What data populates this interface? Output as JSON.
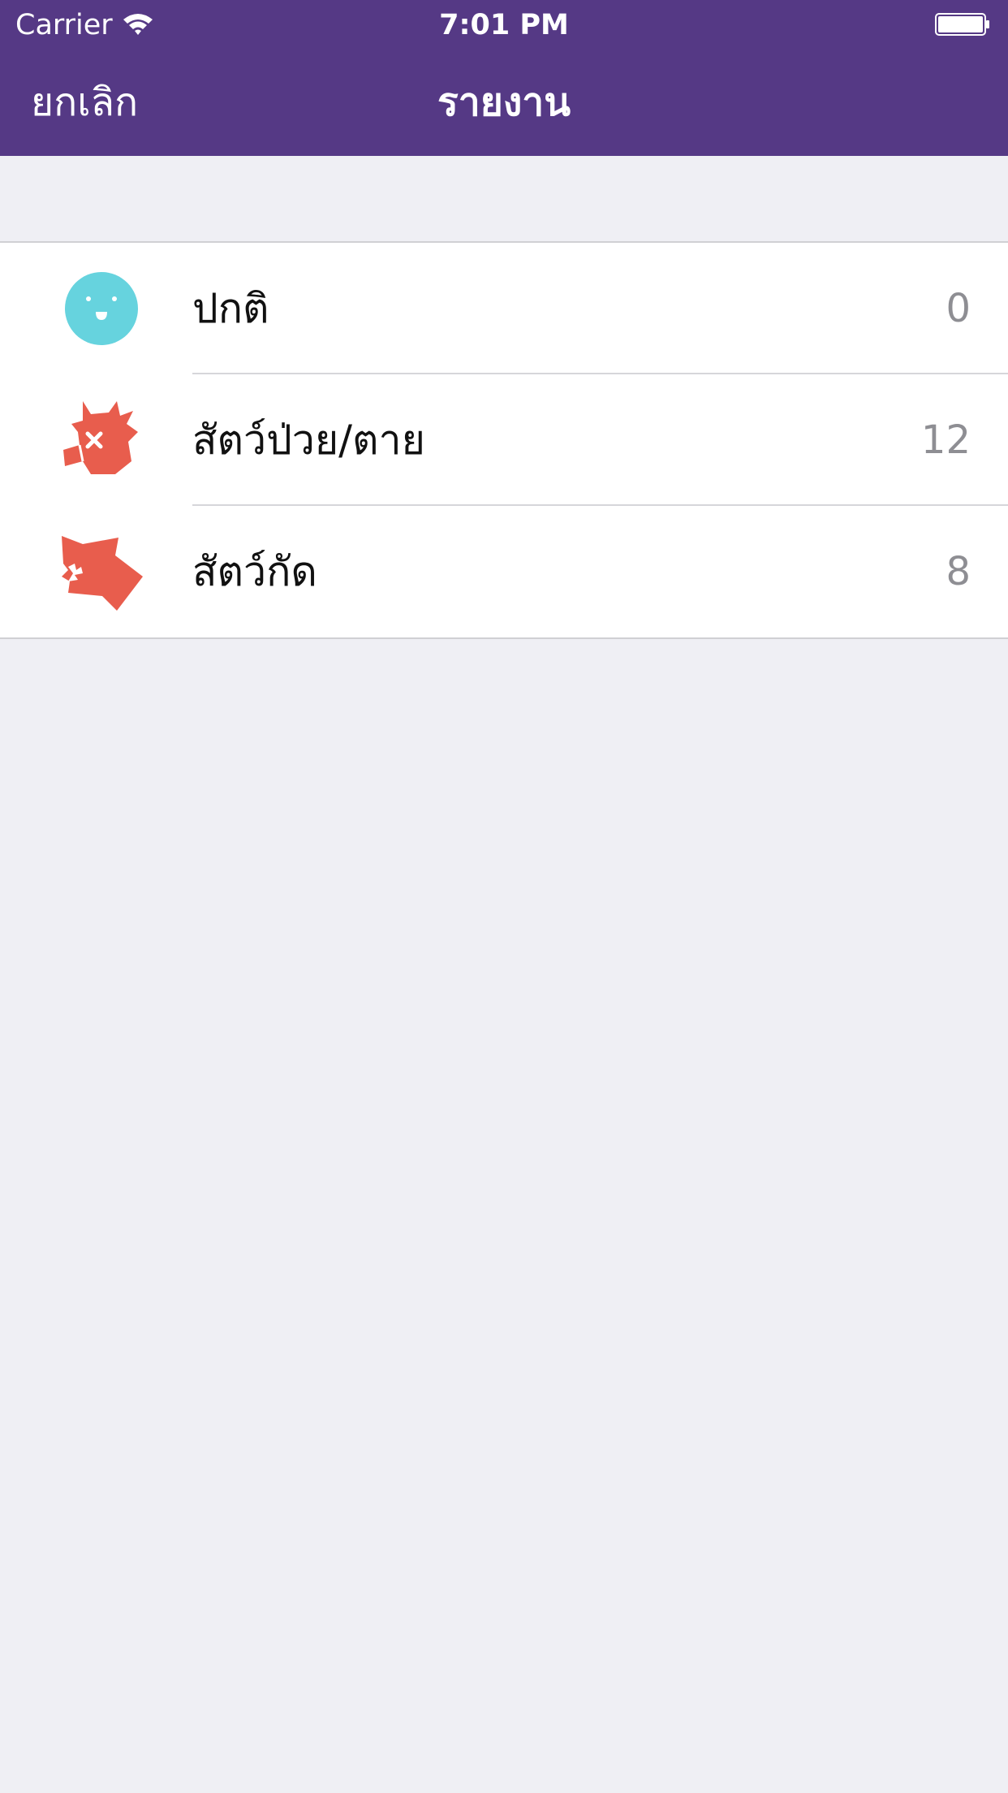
{
  "status_bar": {
    "carrier": "Carrier",
    "time": "7:01 PM"
  },
  "nav": {
    "cancel_label": "ยกเลิก",
    "title": "รายงาน"
  },
  "report_items": [
    {
      "label": "ปกติ",
      "count": "0",
      "icon": "smiley-face-icon"
    },
    {
      "label": "สัตว์ป่วย/ตาย",
      "count": "12",
      "icon": "sick-animal-icon"
    },
    {
      "label": "สัตว์กัด",
      "count": "8",
      "icon": "biting-animal-icon"
    }
  ],
  "colors": {
    "header": "#553985",
    "background": "#efeff4",
    "normal_icon": "#66d3de",
    "alert_icon": "#e85d4d"
  }
}
